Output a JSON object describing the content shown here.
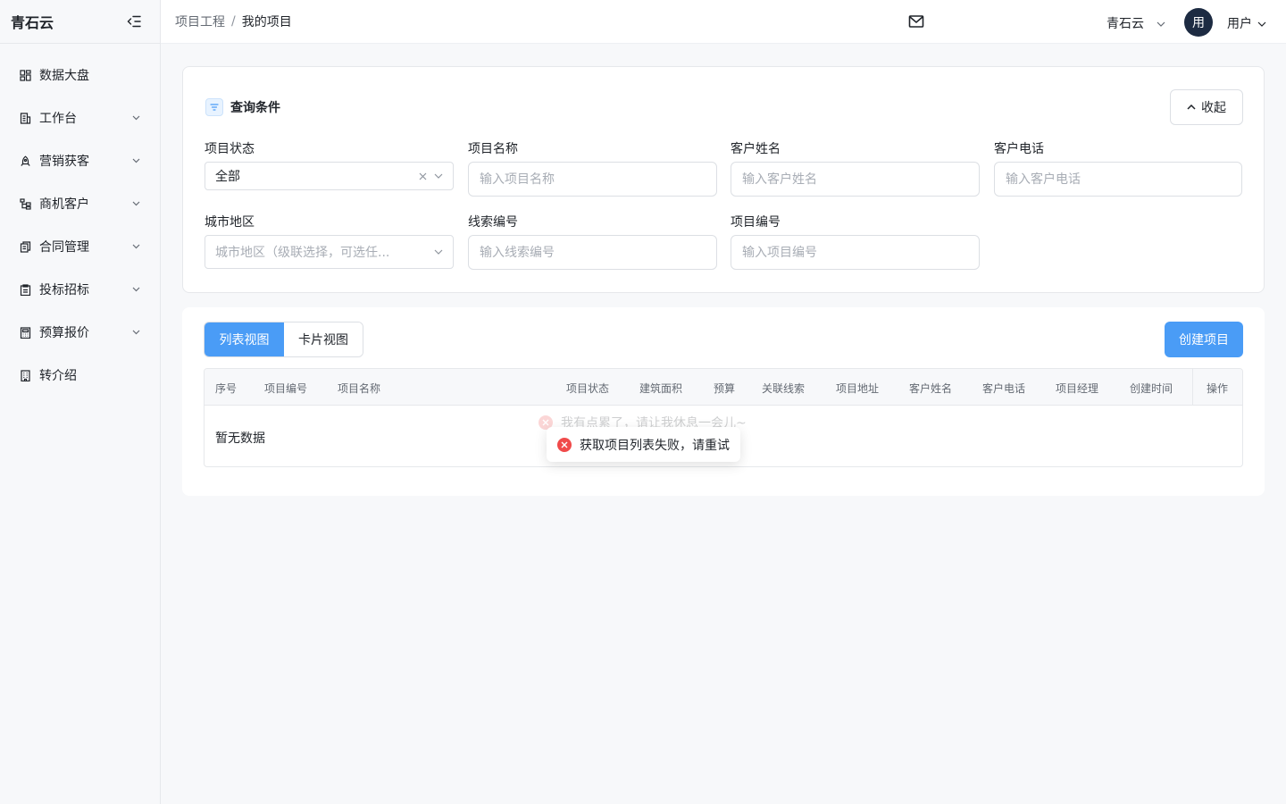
{
  "sidebar": {
    "brand": "青石云",
    "items": [
      {
        "label": "数据大盘",
        "icon": "dashboard-icon",
        "has_children": false
      },
      {
        "label": "工作台",
        "icon": "workbench-icon",
        "has_children": true
      },
      {
        "label": "营销获客",
        "icon": "marketing-icon",
        "has_children": true
      },
      {
        "label": "商机客户",
        "icon": "customer-icon",
        "has_children": true
      },
      {
        "label": "合同管理",
        "icon": "contract-icon",
        "has_children": true
      },
      {
        "label": "投标招标",
        "icon": "bidding-icon",
        "has_children": true
      },
      {
        "label": "预算报价",
        "icon": "calculator-icon",
        "has_children": true
      },
      {
        "label": "转介绍",
        "icon": "building-icon",
        "has_children": false
      }
    ]
  },
  "header": {
    "breadcrumb": {
      "parent": "项目工程",
      "separator": "/",
      "current": "我的项目"
    },
    "tenant": "青石云",
    "avatar_text": "用",
    "user": "用户"
  },
  "query": {
    "title": "查询条件",
    "collapse_label": "收起",
    "fields": {
      "status": {
        "label": "项目状态",
        "value": "全部"
      },
      "project_name": {
        "label": "项目名称",
        "placeholder": "输入项目名称"
      },
      "customer_name": {
        "label": "客户姓名",
        "placeholder": "输入客户姓名"
      },
      "customer_phone": {
        "label": "客户电话",
        "placeholder": "输入客户电话"
      },
      "city": {
        "label": "城市地区",
        "placeholder": "城市地区（级联选择，可选任..."
      },
      "lead_no": {
        "label": "线索编号",
        "placeholder": "输入线索编号"
      },
      "project_no": {
        "label": "项目编号",
        "placeholder": "输入项目编号"
      }
    }
  },
  "list": {
    "view_tabs": [
      "列表视图",
      "卡片视图"
    ],
    "active_view": "列表视图",
    "create_label": "创建项目",
    "columns": [
      "序号",
      "项目编号",
      "项目名称",
      "项目状态",
      "建筑面积",
      "预算",
      "关联线索",
      "项目地址",
      "客户姓名",
      "客户电话",
      "项目经理",
      "创建时间",
      "操作"
    ],
    "empty_text": "暂无数据"
  },
  "toasts": {
    "ghost": "我有点累了，请让我休息一会儿~",
    "error": "获取项目列表失败，请重试"
  },
  "colors": {
    "primary": "#4a9cf6",
    "error": "#f04a4a",
    "avatar_bg": "#1d2b42"
  }
}
